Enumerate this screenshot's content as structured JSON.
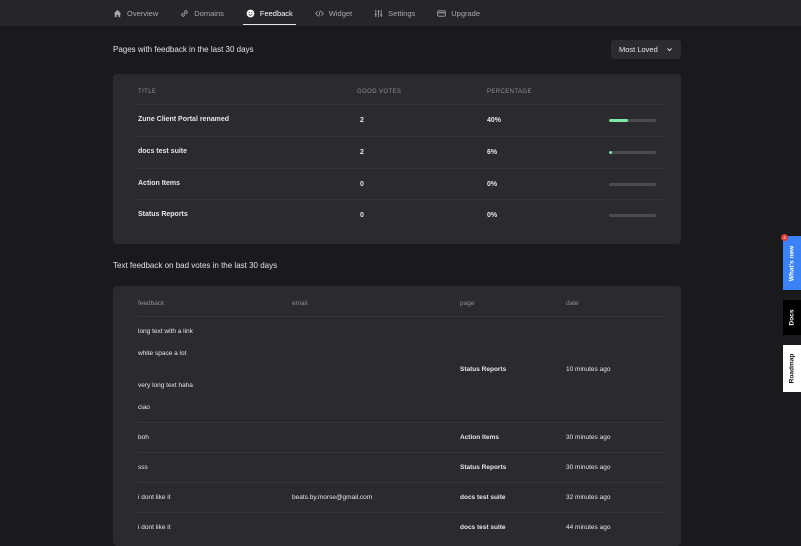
{
  "nav": {
    "items": [
      {
        "label": "Overview",
        "icon": "home-icon"
      },
      {
        "label": "Domains",
        "icon": "link-icon"
      },
      {
        "label": "Feedback",
        "icon": "smile-icon",
        "active": true
      },
      {
        "label": "Widget",
        "icon": "code-icon"
      },
      {
        "label": "Settings",
        "icon": "sliders-icon"
      },
      {
        "label": "Upgrade",
        "icon": "card-icon"
      }
    ]
  },
  "pages_section": {
    "title": "Pages with feedback in the last 30 days",
    "sort_dropdown": "Most Loved",
    "columns": {
      "title": "TITLE",
      "good_votes": "GOOD VOTES",
      "percentage": "PERCENTAGE"
    },
    "rows": [
      {
        "title": "Zune Client Portal renamed",
        "good_votes": "2",
        "percentage": "40%",
        "progress": 0.4
      },
      {
        "title": "docs test suite",
        "good_votes": "2",
        "percentage": "6%",
        "progress": 0.06
      },
      {
        "title": "Action Items",
        "good_votes": "0",
        "percentage": "0%",
        "progress": 0
      },
      {
        "title": "Status Reports",
        "good_votes": "0",
        "percentage": "0%",
        "progress": 0
      }
    ]
  },
  "text_section": {
    "title": "Text feedback on bad votes in the last 30 days",
    "columns": {
      "feedback": "feedback",
      "email": "email",
      "page": "page",
      "date": "date"
    },
    "first_row": {
      "feedback_lines": [
        "long text with a link",
        "white space a lot",
        "very long text haha",
        "ciao"
      ],
      "email": "",
      "page": "Status Reports",
      "date": "10 minutes ago"
    },
    "rows": [
      {
        "feedback": "boh",
        "email": "",
        "page": "Action Items",
        "date": "30 minutes ago"
      },
      {
        "feedback": "sss",
        "email": "",
        "page": "Status Reports",
        "date": "30 minutes ago"
      },
      {
        "feedback": "i dont like it",
        "email": "beats.by.morse@gmail.com",
        "page": "docs test suite",
        "date": "32 minutes ago"
      },
      {
        "feedback": "i dont like it",
        "email": "",
        "page": "docs test suite",
        "date": "44 minutes ago"
      }
    ]
  },
  "side_tabs": {
    "whats_new": "What's new",
    "whats_new_badge": "4",
    "docs": "Docs",
    "roadmap": "Roadmap"
  },
  "colors": {
    "background": "#1a1a1d",
    "card": "#2b2b2f",
    "progress_fill": "#7ee8a6",
    "whats_new_tab": "#3b82f6",
    "docs_tab": "#000000",
    "roadmap_tab": "#ffffff"
  }
}
